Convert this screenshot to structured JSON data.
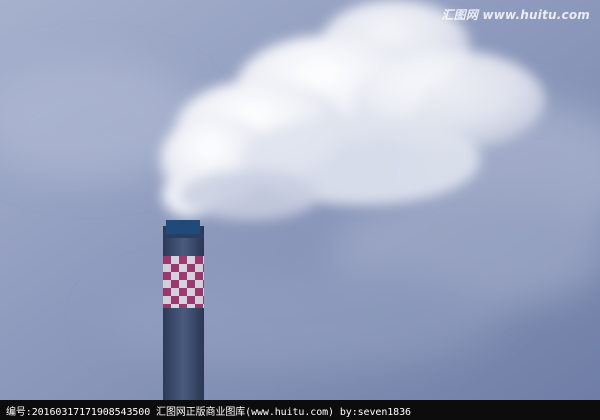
{
  "watermark": {
    "text": "汇图网 www.huitu.com"
  },
  "caption": {
    "text": "编号:20160317171908543500   汇图网正版商业图库(www.huitu.com) by:seven1836"
  },
  "colors": {
    "sky": "#7e8cb0",
    "smoke": "#eef0f7",
    "chimney_body": "#3f4f6e",
    "chimney_cap": "#1f4a7a",
    "checker_red": "#b0356f",
    "checker_white": "#f4eef3",
    "caption_bar": "#0c0c0c"
  }
}
